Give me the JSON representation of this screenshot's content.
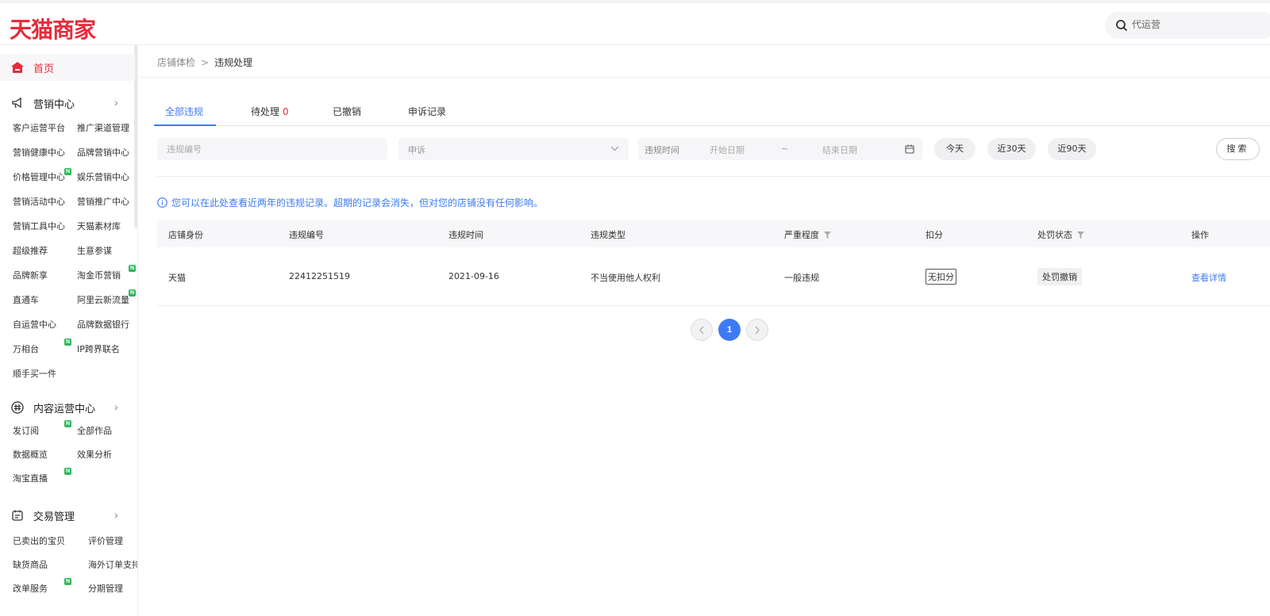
{
  "header": {
    "logo": "天猫商家",
    "search_placeholder": "代运营"
  },
  "sidebar": {
    "home": "首页",
    "groups": [
      {
        "title": "营销中心",
        "items": [
          "客户运营平台",
          "推广渠道管理",
          "营销健康中心",
          "品牌营销中心",
          "价格管理中心",
          "娱乐营销中心",
          "营销活动中心",
          "营销推广中心",
          "营销工具中心",
          "天猫素材库",
          "超级推荐",
          "生意参谋",
          "品牌新享",
          "淘金币营销",
          "直通车",
          "阿里云新流量",
          "自运营中心",
          "品牌数据银行",
          "万相台",
          "IP跨界联名",
          "顺手买一件"
        ]
      },
      {
        "title": "内容运营中心",
        "items": [
          "发订阅",
          "全部作品",
          "数据概览",
          "效果分析",
          "淘宝直播"
        ]
      },
      {
        "title": "交易管理",
        "items": [
          "已卖出的宝贝",
          "评价管理",
          "缺货商品",
          "海外订单支持",
          "改单服务",
          "分期管理"
        ]
      }
    ],
    "badge": "N"
  },
  "breadcrumb": {
    "parent": "店铺体检",
    "separator": ">",
    "current": "违规处理"
  },
  "tabs": [
    {
      "label": "全部违规"
    },
    {
      "label": "待处理",
      "count": "0"
    },
    {
      "label": "已撤销"
    },
    {
      "label": "申诉记录"
    }
  ],
  "filters": {
    "violation_no_placeholder": "违规编号",
    "appeal_select": "申诉",
    "date_label": "违规时间",
    "start_placeholder": "开始日期",
    "tilde": "~",
    "end_placeholder": "结束日期",
    "today": "今天",
    "last30": "近30天",
    "last90": "近90天",
    "search": "搜索"
  },
  "notice": "您可以在此处查看近两年的违规记录。超期的记录会消失，但对您的店铺没有任何影响。",
  "table": {
    "columns": [
      "店铺身份",
      "违规编号",
      "违规时间",
      "违规类型",
      "严重程度",
      "扣分",
      "处罚状态",
      "操作"
    ],
    "rows": [
      {
        "identity": "天猫",
        "number": "22412251519",
        "time": "2021-09-16",
        "type": "不当使用他人权利",
        "severity": "一般违规",
        "points": "无扣分",
        "status": "处罚撤销",
        "action": "查看详情"
      }
    ]
  },
  "pagination": {
    "current": "1"
  },
  "colors": {
    "brand": "#e62c3c",
    "accent": "#3d7bf5",
    "new_badge": "#2fb85b"
  }
}
